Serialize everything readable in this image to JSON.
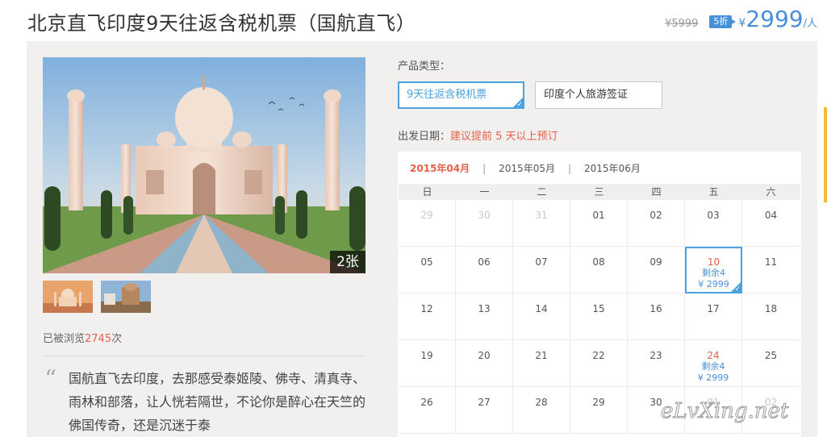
{
  "header": {
    "title": "北京直飞印度9天往返含税机票（国航直飞）",
    "original_price": "¥5999",
    "discount": "5折",
    "currency": "¥",
    "price": "2999",
    "per_person": "/人"
  },
  "gallery": {
    "photo_count": "2张",
    "thumbnail_count": 2
  },
  "views": {
    "prefix": "已被浏览",
    "count": "2745",
    "suffix": "次"
  },
  "description": {
    "quote_mark": "“",
    "text": "国航直飞去印度，去那感受泰姬陵、佛寺、清真寺、雨林和部落，让人恍若隔世，不论你是醉心在天竺的佛国传奇，还是沉迷于泰"
  },
  "product_type": {
    "label": "产品类型：",
    "options": [
      {
        "label": "9天往返含税机票",
        "selected": true
      },
      {
        "label": "印度个人旅游签证",
        "selected": false
      }
    ]
  },
  "departure": {
    "label": "出发日期：",
    "hint": "建议提前 5 天以上预订"
  },
  "calendar": {
    "months": [
      {
        "label": "2015年04月",
        "active": true
      },
      {
        "label": "2015年05月",
        "active": false
      },
      {
        "label": "2015年06月",
        "active": false
      }
    ],
    "separator": "|",
    "weekdays": [
      "日",
      "一",
      "二",
      "三",
      "四",
      "五",
      "六"
    ],
    "cells": [
      {
        "day": "29",
        "other": true
      },
      {
        "day": "30",
        "other": true
      },
      {
        "day": "31",
        "other": true
      },
      {
        "day": "01"
      },
      {
        "day": "02"
      },
      {
        "day": "03"
      },
      {
        "day": "04"
      },
      {
        "day": "05"
      },
      {
        "day": "06"
      },
      {
        "day": "07"
      },
      {
        "day": "08"
      },
      {
        "day": "09"
      },
      {
        "day": "10",
        "available": true,
        "selected": true,
        "remain": "剩余4",
        "price": "¥ 2999"
      },
      {
        "day": "11"
      },
      {
        "day": "12"
      },
      {
        "day": "13"
      },
      {
        "day": "14"
      },
      {
        "day": "15"
      },
      {
        "day": "16"
      },
      {
        "day": "17"
      },
      {
        "day": "18"
      },
      {
        "day": "19"
      },
      {
        "day": "20"
      },
      {
        "day": "21"
      },
      {
        "day": "22"
      },
      {
        "day": "23"
      },
      {
        "day": "24",
        "available": true,
        "remain": "剩余4",
        "price": "¥ 2999"
      },
      {
        "day": "25"
      },
      {
        "day": "26"
      },
      {
        "day": "27"
      },
      {
        "day": "28"
      },
      {
        "day": "29"
      },
      {
        "day": "30"
      },
      {
        "day": "01",
        "other": true
      },
      {
        "day": "02",
        "other": true
      }
    ]
  },
  "watermark": "eLvXing.net",
  "colors": {
    "accent": "#4a90d9",
    "highlight": "#e8604c",
    "selected_border": "#4aa3df"
  }
}
